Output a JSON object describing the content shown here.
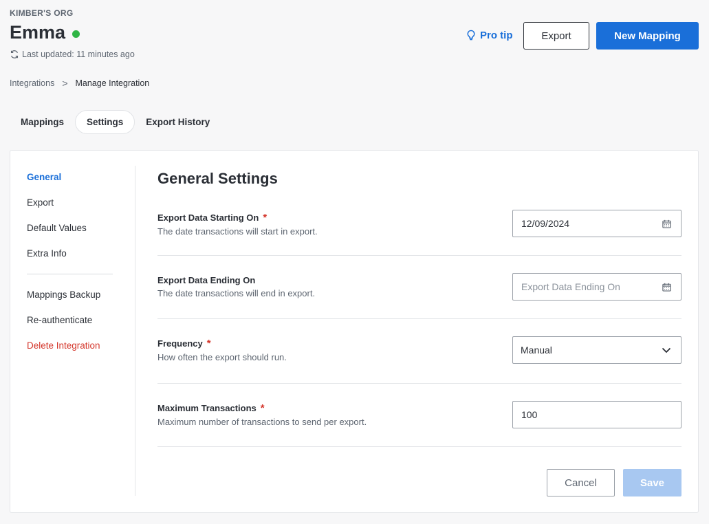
{
  "header": {
    "org": "KIMBER'S ORG",
    "title": "Emma",
    "last_updated": "Last updated: 11 minutes ago",
    "status_color": "#2fb545",
    "pro_tip": "Pro tip",
    "export_label": "Export",
    "new_mapping_label": "New Mapping"
  },
  "breadcrumb": {
    "parent": "Integrations",
    "separator": ">",
    "current": "Manage Integration"
  },
  "tabs": [
    {
      "label": "Mappings"
    },
    {
      "label": "Settings",
      "active": true
    },
    {
      "label": "Export History"
    }
  ],
  "sidenav": {
    "items": [
      {
        "label": "General",
        "active": true
      },
      {
        "label": "Export"
      },
      {
        "label": "Default Values"
      },
      {
        "label": "Extra Info"
      }
    ],
    "items2": [
      {
        "label": "Mappings Backup"
      },
      {
        "label": "Re-authenticate"
      },
      {
        "label": "Delete Integration",
        "danger": true
      }
    ]
  },
  "settings": {
    "heading": "General Settings",
    "fields": [
      {
        "label": "Export Data Starting On",
        "required": true,
        "description": "The date transactions will start in export.",
        "value": "12/09/2024",
        "icon": "calendar-icon"
      },
      {
        "label": "Export Data Ending On",
        "required": false,
        "description": "The date transactions will end in export.",
        "placeholder": "Export Data Ending On",
        "icon": "calendar-icon"
      },
      {
        "label": "Frequency",
        "required": true,
        "description": "How often the export should run.",
        "value": "Manual",
        "icon": "chevron-down-icon"
      },
      {
        "label": "Maximum Transactions",
        "required": true,
        "description": "Maximum number of transactions to send per export.",
        "value": "100"
      }
    ],
    "required_mark": "*",
    "cancel_label": "Cancel",
    "save_label": "Save"
  },
  "colors": {
    "accent": "#1a6fd9",
    "danger": "#d4362b",
    "save_disabled": "#a8c8f1"
  }
}
